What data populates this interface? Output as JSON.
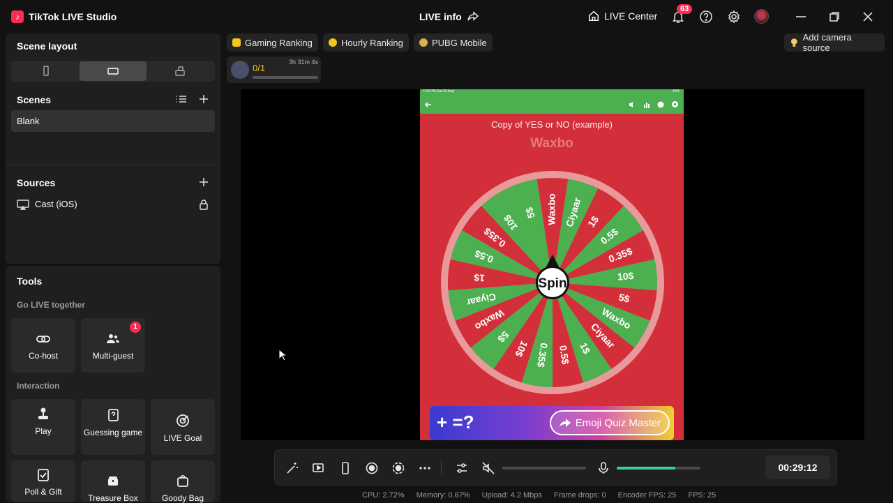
{
  "app": {
    "title": "TikTok LIVE Studio",
    "live_info": "LIVE info",
    "live_center": "LIVE Center",
    "notification_count": "63",
    "accent_color": "#fe2c55"
  },
  "left": {
    "scene_layout_title": "Scene layout",
    "scenes_title": "Scenes",
    "scenes": [
      "Blank"
    ],
    "sources_title": "Sources",
    "sources": [
      {
        "label": "Cast (iOS)",
        "icon": "airplay-icon",
        "locked": true
      }
    ],
    "tools_title": "Tools",
    "go_live_together": "Go LIVE together",
    "cohost": "Co-host",
    "multiguest": "Multi-guest",
    "multiguest_badge": "1",
    "interaction": "Interaction",
    "play": "Play",
    "guessing_game": "Guessing game",
    "live_goal": "LIVE Goal",
    "poll_gift": "Poll & Gift",
    "treasure_box": "Treasure Box",
    "goody_bag": "Goody Bag"
  },
  "topbar": {
    "chips": [
      "Gaming Ranking",
      "Hourly Ranking",
      "PUBG Mobile"
    ],
    "add_camera": "Add camera source",
    "goal_count": "0/1",
    "goal_time": "3h 31m 4s"
  },
  "phone": {
    "status_time": "7:18 PM  Sat 23 Aug",
    "status_battery": "44%",
    "title": "Copy of YES or NO (example)",
    "subtitle": "Waxbo",
    "spin": "Spin",
    "wheel_labels": [
      "5$",
      "Waxbo",
      "Ciyaar",
      "1$",
      "0.5$",
      "0.35$",
      "10$",
      "5$",
      "Waxbo",
      "Ciyaar",
      "1$",
      "0.5$",
      "0.35$",
      "10$",
      "5$",
      "Waxbo",
      "Ciyaar",
      "1$",
      "0.5$",
      "0.35$",
      "10$"
    ],
    "wheel_colors": [
      "#4caf50",
      "#d32f3a"
    ],
    "banner_text": "Emoji Quiz Master",
    "banner_eq": "+  =?"
  },
  "controls": {
    "timer": "00:29:12",
    "speaker_level": 0,
    "mic_level": 0.7
  },
  "stats": {
    "cpu": "CPU:  2.72%",
    "memory": "Memory:  0.67%",
    "upload": "Upload:  4.2 Mbps",
    "frame_drops": "Frame drops:  0",
    "encoder_fps": "Encoder FPS:  25",
    "fps": "FPS:  25"
  }
}
